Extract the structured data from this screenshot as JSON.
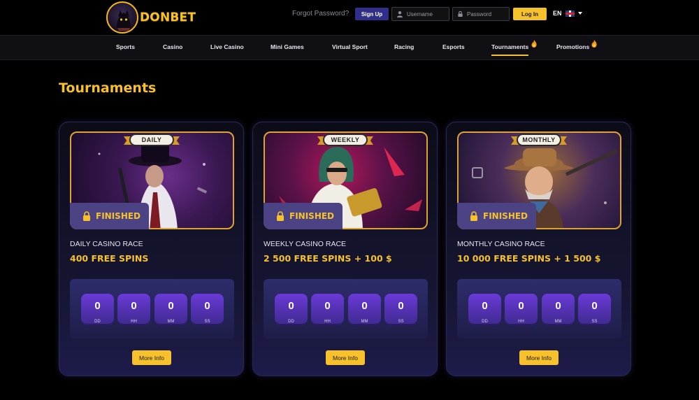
{
  "header": {
    "logo_text": "DONBET",
    "forgot_password": "Forgot Password?",
    "signup_label": "Sign Up",
    "username_placeholder": "Username",
    "password_placeholder": "Password",
    "login_label": "Log In",
    "language": "EN",
    "icons": [
      "user-icon",
      "lock-icon",
      "uk-flag-icon",
      "caret-down-icon"
    ]
  },
  "nav": {
    "items": [
      {
        "label": "Sports"
      },
      {
        "label": "Casino"
      },
      {
        "label": "Live Casino"
      },
      {
        "label": "Mini Games"
      },
      {
        "label": "Virtual Sport"
      },
      {
        "label": "Racing"
      },
      {
        "label": "Esports"
      },
      {
        "label": "Tournaments",
        "active": true,
        "icon": "fire-icon"
      },
      {
        "label": "Promotions",
        "icon": "fire-icon"
      }
    ]
  },
  "page": {
    "title": "Tournaments"
  },
  "tournaments": [
    {
      "ribbon": "DAILY",
      "status": "FINISHED",
      "name": "DAILY CASINO RACE",
      "prize": "400 FREE SPINS",
      "timer": {
        "dd": "0",
        "hh": "0",
        "mm": "0",
        "ss": "0"
      },
      "labels": {
        "dd": "DD",
        "hh": "HH",
        "mm": "MM",
        "ss": "SS"
      },
      "button": "More Info"
    },
    {
      "ribbon": "WEEKLY",
      "status": "FINISHED",
      "name": "WEEKLY CASINO RACE",
      "prize": "2 500 FREE SPINS + 100 $",
      "timer": {
        "dd": "0",
        "hh": "0",
        "mm": "0",
        "ss": "0"
      },
      "labels": {
        "dd": "DD",
        "hh": "HH",
        "mm": "MM",
        "ss": "SS"
      },
      "button": "More Info"
    },
    {
      "ribbon": "MONTHLY",
      "status": "FINISHED",
      "name": "MONTHLY CASINO RACE",
      "prize": "10 000 FREE SPINS + 1 500 $",
      "timer": {
        "dd": "0",
        "hh": "0",
        "mm": "0",
        "ss": "0"
      },
      "labels": {
        "dd": "DD",
        "hh": "HH",
        "mm": "MM",
        "ss": "SS"
      },
      "button": "More Info"
    }
  ],
  "colors": {
    "accent": "#f6c12b",
    "background": "#000000",
    "signup_bg": "#2f2f8a",
    "badge_bg": "#4b4383",
    "timer_box": "#5a34c0"
  }
}
